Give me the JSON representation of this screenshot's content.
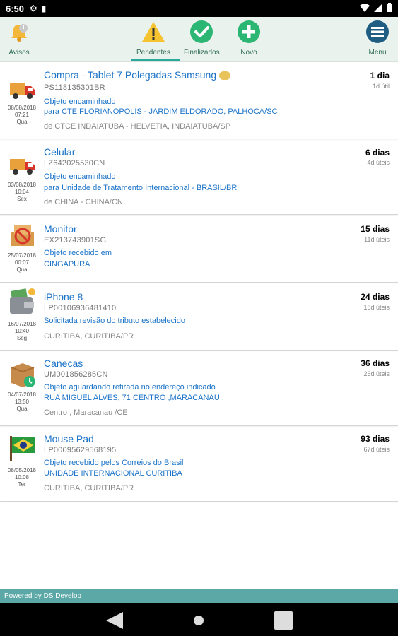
{
  "status_bar": {
    "time": "6:50"
  },
  "toolbar": {
    "avisos": "Avisos",
    "pendentes": "Pendentes",
    "finalizados": "Finalizados",
    "novo": "Novo",
    "menu": "Menu"
  },
  "items": [
    {
      "date": "08/08/2018",
      "time": "07:21",
      "weekday": "Qua",
      "title": "Compra - Tablet 7 Polegadas Samsung",
      "code": "PS118135301BR",
      "status": "Objeto encaminhado",
      "dest": "para CTE FLORIANOPOLIS - JARDIM ELDORADO, PALHOCA/SC",
      "orig": "de CTCE INDAIATUBA - HELVETIA, INDAIATUBA/SP",
      "days": "1 dia",
      "util": "1d útil",
      "icon": "truck-icon"
    },
    {
      "date": "03/08/2018",
      "time": "10:04",
      "weekday": "Sex",
      "title": "Celular",
      "code": "LZ642025530CN",
      "status": "Objeto encaminhado",
      "dest": "para Unidade de Tratamento Internacional - BRASIL/BR",
      "orig": "de CHINA - CHINA/CN",
      "days": "6 dias",
      "util": "4d úteis",
      "icon": "truck-icon"
    },
    {
      "date": "25/07/2018",
      "time": "00:07",
      "weekday": "Qua",
      "title": "Monitor",
      "code": "EX213743901SG",
      "status": "Objeto recebido em",
      "dest": "CINGAPURA",
      "orig": "",
      "days": "15 dias",
      "util": "11d úteis",
      "icon": "customs-icon"
    },
    {
      "date": "16/07/2018",
      "time": "10:40",
      "weekday": "Seg",
      "title": "iPhone 8",
      "code": "LP00106936481410",
      "status": "Solicitada revisão do tributo estabelecido",
      "dest": "",
      "orig": "CURITIBA, CURITIBA/PR",
      "days": "24 dias",
      "util": "18d úteis",
      "icon": "wallet-icon"
    },
    {
      "date": "04/07/2018",
      "time": "13:50",
      "weekday": "Qua",
      "title": "Canecas",
      "code": "UM001856285CN",
      "status": "Objeto aguardando retirada no endereço indicado",
      "dest": "RUA MIGUEL ALVES, 71 CENTRO ,MARACANAU ,",
      "orig": "Centro , Maracanau /CE",
      "days": "36 dias",
      "util": "26d úteis",
      "icon": "box-clock-icon"
    },
    {
      "date": "08/05/2018",
      "time": "10:08",
      "weekday": "Ter",
      "title": "Mouse Pad",
      "code": "LP00095629568195",
      "status": "Objeto recebido pelos Correios do Brasil",
      "dest": "UNIDADE INTERNACIONAL CURITIBA",
      "orig": "CURITIBA, CURITIBA/PR",
      "days": "93 dias",
      "util": "67d úteis",
      "icon": "brazil-flag-icon"
    }
  ],
  "footer": {
    "text": "Powered by DS Develop"
  }
}
